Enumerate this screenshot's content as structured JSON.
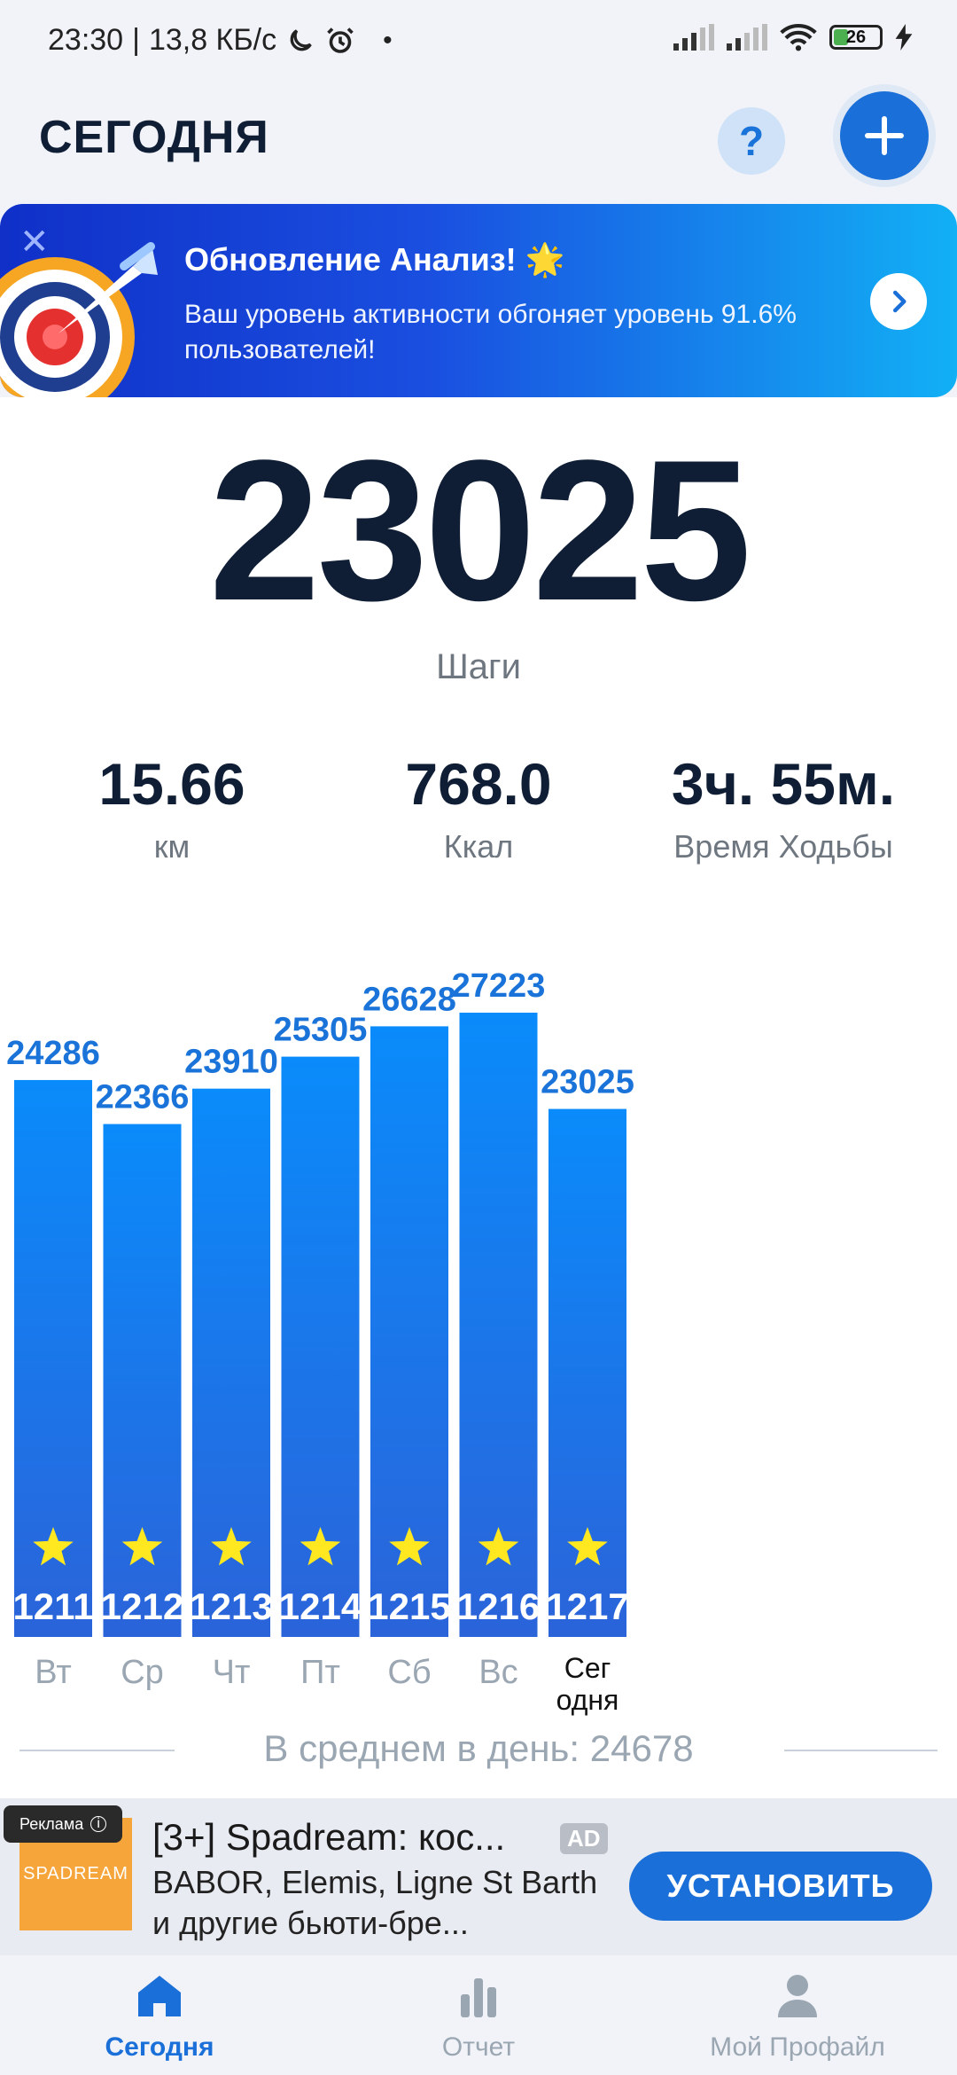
{
  "status_bar": {
    "time": "23:30",
    "speed": "13,8 КБ/с",
    "battery": "26",
    "icons": [
      "moon-icon",
      "alarm-icon",
      "signal-icon",
      "signal-icon",
      "wifi-icon",
      "battery-icon",
      "charging-icon"
    ]
  },
  "header": {
    "title": "СЕГОДНЯ",
    "help": "?"
  },
  "banner": {
    "title": "Обновление Анализ! 🌟",
    "text": "Ваш уровень активности обгоняет уровень 91.6% пользователей!",
    "close": "✕"
  },
  "steps": {
    "value": "23025",
    "label": "Шаги"
  },
  "stats": [
    {
      "value": "15.66",
      "label": "км"
    },
    {
      "value": "768.0",
      "label": "Ккал"
    },
    {
      "value": "3ч. 55м.",
      "label": "Время Ходьбы"
    }
  ],
  "chart_data": {
    "type": "bar",
    "categories": [
      "Вт",
      "Ср",
      "Чт",
      "Пт",
      "Сб",
      "Вс",
      "Сег одня"
    ],
    "values": [
      24286,
      22366,
      23910,
      25305,
      26628,
      27223,
      23025
    ],
    "bar_badges": [
      "1211",
      "1212",
      "1213",
      "1214",
      "1215",
      "1216",
      "1217"
    ],
    "highlight_index": 6,
    "colors": {
      "bar_top": "#0a8bfb",
      "bar_bottom": "#2b63d9",
      "value_label": "#1a73d9",
      "star": "#ffe81f"
    }
  },
  "average": "В среднем в день: 24678",
  "ad": {
    "badge": "Реклама",
    "logo": "SPADREAM",
    "title": "[3+] Spadream: кос...",
    "tag": "AD",
    "desc": "BABOR, Elemis, Ligne St Barth и другие бьюти-бре...",
    "button": "УСТАНОВИТЬ"
  },
  "tabs": [
    {
      "label": "Сегодня",
      "icon": "home-icon",
      "active": true
    },
    {
      "label": "Отчет",
      "icon": "bar-chart-icon",
      "active": false
    },
    {
      "label": "Мой Профайл",
      "icon": "profile-icon",
      "active": false
    }
  ]
}
